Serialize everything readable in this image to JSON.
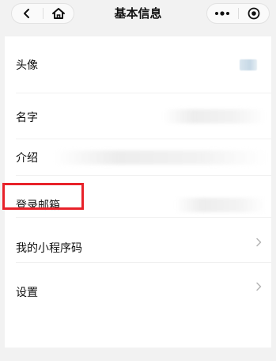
{
  "nav": {
    "title": "基本信息",
    "back_icon": "chevron-left-icon",
    "home_icon": "home-icon",
    "more_icon": "more-dots-icon",
    "close_icon": "target-close-icon"
  },
  "rows": [
    {
      "label": "头像",
      "value_icon": "avatar-thumbnail"
    },
    {
      "label": "名字"
    },
    {
      "label": "介绍"
    },
    {
      "label": "登录邮箱",
      "highlighted": true,
      "highlight_color": "#e8222a"
    },
    {
      "label": "我的小程序码",
      "chevron": true
    },
    {
      "label": "设置",
      "chevron": true
    }
  ]
}
